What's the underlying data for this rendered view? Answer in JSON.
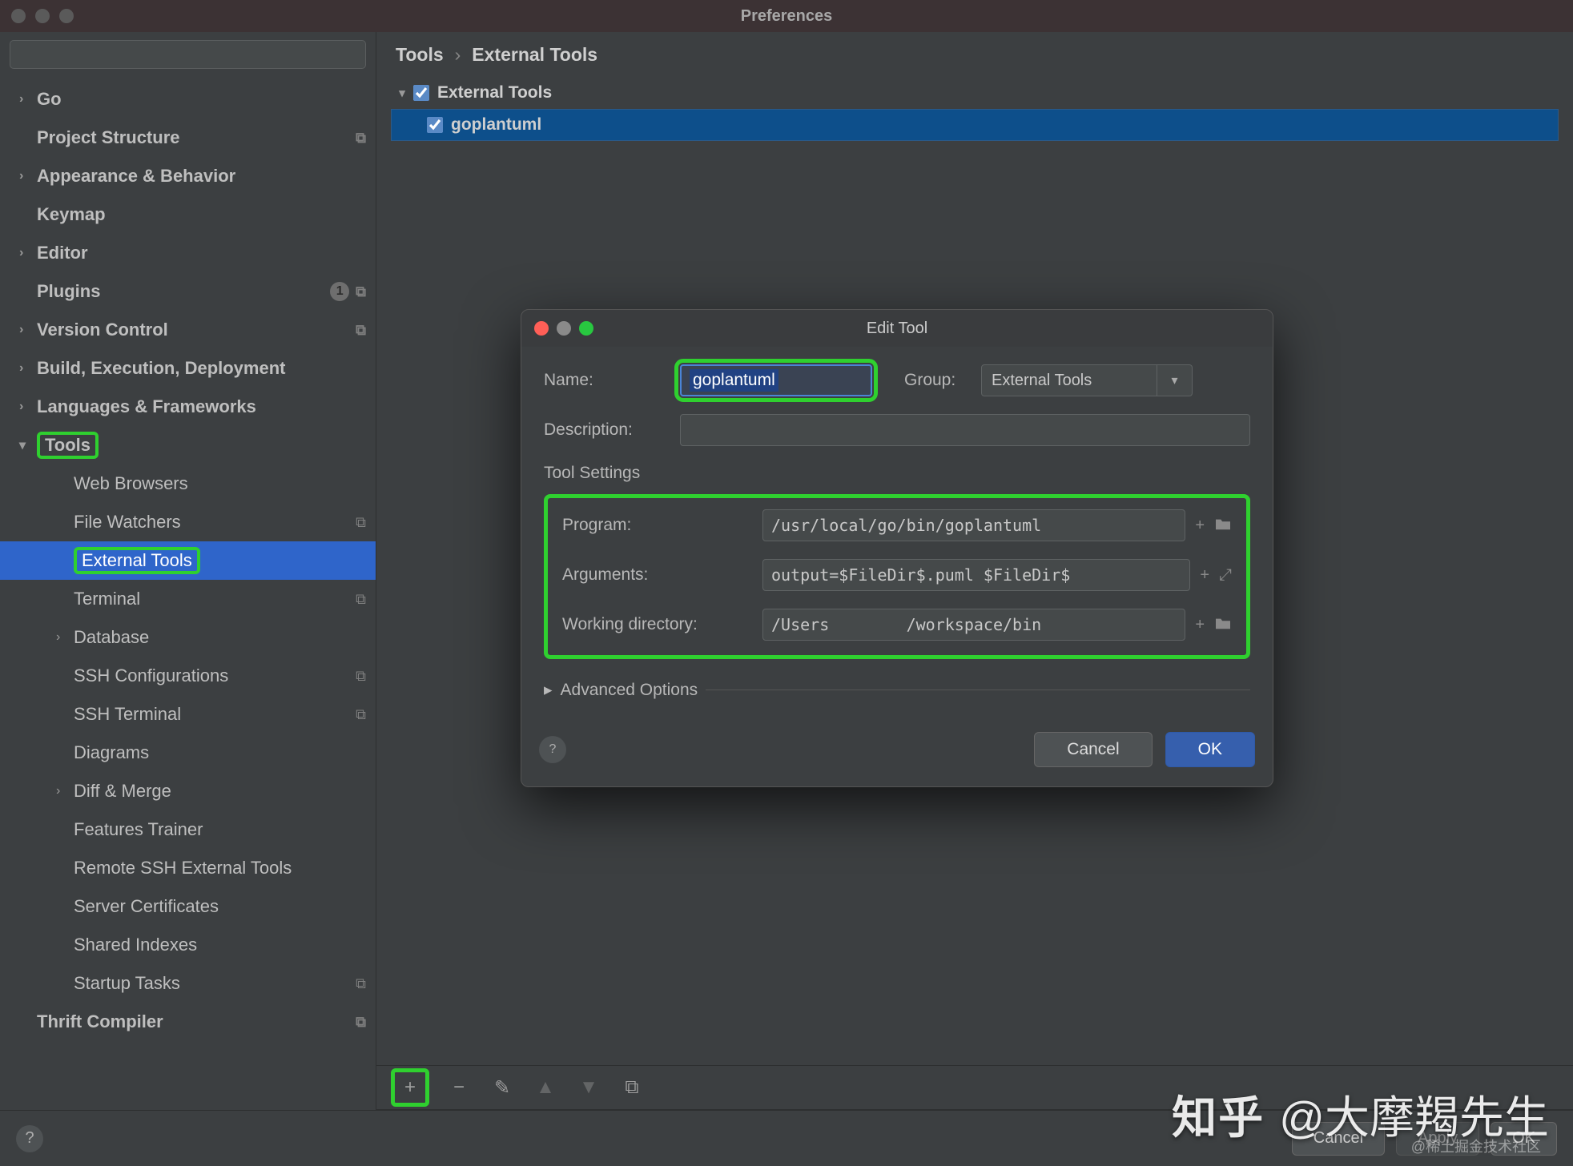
{
  "window": {
    "title": "Preferences"
  },
  "sidebar": {
    "items": [
      {
        "label": "Go",
        "bold": true,
        "chev": true
      },
      {
        "label": "Project Structure",
        "bold": true,
        "copy": true
      },
      {
        "label": "Appearance & Behavior",
        "bold": true,
        "chev": true
      },
      {
        "label": "Keymap",
        "bold": true
      },
      {
        "label": "Editor",
        "bold": true,
        "chev": true
      },
      {
        "label": "Plugins",
        "bold": true,
        "badge": "1",
        "copy": true
      },
      {
        "label": "Version Control",
        "bold": true,
        "chev": true,
        "copy": true
      },
      {
        "label": "Build, Execution, Deployment",
        "bold": true,
        "chev": true
      },
      {
        "label": "Languages & Frameworks",
        "bold": true,
        "chev": true
      },
      {
        "label": "Tools",
        "bold": true,
        "chev": true,
        "open": true,
        "highlight": true
      },
      {
        "label": "Web Browsers",
        "sub": true
      },
      {
        "label": "File Watchers",
        "sub": true,
        "copy": true
      },
      {
        "label": "External Tools",
        "sub": true,
        "selected": true,
        "highlight": true
      },
      {
        "label": "Terminal",
        "sub": true,
        "copy": true
      },
      {
        "label": "Database",
        "sub": true,
        "chev": true
      },
      {
        "label": "SSH Configurations",
        "sub": true,
        "copy": true
      },
      {
        "label": "SSH Terminal",
        "sub": true,
        "copy": true
      },
      {
        "label": "Diagrams",
        "sub": true
      },
      {
        "label": "Diff & Merge",
        "sub": true,
        "chev": true
      },
      {
        "label": "Features Trainer",
        "sub": true
      },
      {
        "label": "Remote SSH External Tools",
        "sub": true
      },
      {
        "label": "Server Certificates",
        "sub": true
      },
      {
        "label": "Shared Indexes",
        "sub": true
      },
      {
        "label": "Startup Tasks",
        "sub": true,
        "copy": true
      },
      {
        "label": "Thrift Compiler",
        "bold": true,
        "copy": true
      }
    ]
  },
  "breadcrumbs": {
    "root": "Tools",
    "leaf": "External Tools"
  },
  "tree": {
    "group": "External Tools",
    "child": "goplantuml"
  },
  "toolbar": {
    "add": "+",
    "remove": "−",
    "edit": "✎",
    "up": "▲",
    "down": "▼",
    "copy": "⧉"
  },
  "dialog": {
    "title": "Edit Tool",
    "name_label": "Name:",
    "name_value": "goplantuml",
    "group_label": "Group:",
    "group_value": "External Tools",
    "desc_label": "Description:",
    "desc_value": "",
    "section": "Tool Settings",
    "program_label": "Program:",
    "program_value": "/usr/local/go/bin/goplantuml",
    "args_label": "Arguments:",
    "args_value": "output=$FileDir$.puml $FileDir$",
    "workdir_label": "Working directory:",
    "workdir_value": "/Users        /workspace/bin",
    "advanced": "Advanced Options",
    "cancel": "Cancel",
    "ok": "OK"
  },
  "footer": {
    "cancel": "Cancel",
    "apply": "Apply",
    "ok": "OK"
  },
  "watermark": {
    "logo": "知乎",
    "text": "@大摩羯先生",
    "sub": "@稀土掘金技术社区"
  }
}
